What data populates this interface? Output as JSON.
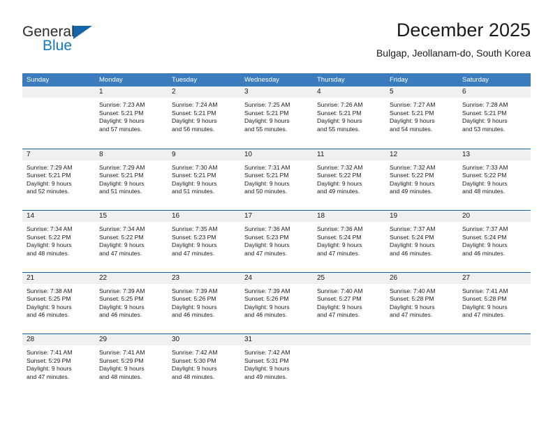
{
  "brand": {
    "name_part1": "General",
    "name_part2": "Blue",
    "accent_color": "#1479bf",
    "triangle_color": "#1565ab"
  },
  "header": {
    "title": "December 2025",
    "subtitle": "Bulgap, Jeollanam-do, South Korea"
  },
  "calendar": {
    "header_bg": "#3a7cbe",
    "rule_color": "#1565ab",
    "daynum_bg": "#f0f0f0",
    "weekday_headers": [
      "Sunday",
      "Monday",
      "Tuesday",
      "Wednesday",
      "Thursday",
      "Friday",
      "Saturday"
    ],
    "weeks": [
      [
        {
          "day": "",
          "sunrise": "",
          "sunset": "",
          "daylight_line1": "",
          "daylight_line2": "",
          "empty": true
        },
        {
          "day": "1",
          "sunrise": "Sunrise: 7:23 AM",
          "sunset": "Sunset: 5:21 PM",
          "daylight_line1": "Daylight: 9 hours",
          "daylight_line2": "and 57 minutes."
        },
        {
          "day": "2",
          "sunrise": "Sunrise: 7:24 AM",
          "sunset": "Sunset: 5:21 PM",
          "daylight_line1": "Daylight: 9 hours",
          "daylight_line2": "and 56 minutes."
        },
        {
          "day": "3",
          "sunrise": "Sunrise: 7:25 AM",
          "sunset": "Sunset: 5:21 PM",
          "daylight_line1": "Daylight: 9 hours",
          "daylight_line2": "and 55 minutes."
        },
        {
          "day": "4",
          "sunrise": "Sunrise: 7:26 AM",
          "sunset": "Sunset: 5:21 PM",
          "daylight_line1": "Daylight: 9 hours",
          "daylight_line2": "and 55 minutes."
        },
        {
          "day": "5",
          "sunrise": "Sunrise: 7:27 AM",
          "sunset": "Sunset: 5:21 PM",
          "daylight_line1": "Daylight: 9 hours",
          "daylight_line2": "and 54 minutes."
        },
        {
          "day": "6",
          "sunrise": "Sunrise: 7:28 AM",
          "sunset": "Sunset: 5:21 PM",
          "daylight_line1": "Daylight: 9 hours",
          "daylight_line2": "and 53 minutes."
        }
      ],
      [
        {
          "day": "7",
          "sunrise": "Sunrise: 7:29 AM",
          "sunset": "Sunset: 5:21 PM",
          "daylight_line1": "Daylight: 9 hours",
          "daylight_line2": "and 52 minutes."
        },
        {
          "day": "8",
          "sunrise": "Sunrise: 7:29 AM",
          "sunset": "Sunset: 5:21 PM",
          "daylight_line1": "Daylight: 9 hours",
          "daylight_line2": "and 51 minutes."
        },
        {
          "day": "9",
          "sunrise": "Sunrise: 7:30 AM",
          "sunset": "Sunset: 5:21 PM",
          "daylight_line1": "Daylight: 9 hours",
          "daylight_line2": "and 51 minutes."
        },
        {
          "day": "10",
          "sunrise": "Sunrise: 7:31 AM",
          "sunset": "Sunset: 5:21 PM",
          "daylight_line1": "Daylight: 9 hours",
          "daylight_line2": "and 50 minutes."
        },
        {
          "day": "11",
          "sunrise": "Sunrise: 7:32 AM",
          "sunset": "Sunset: 5:22 PM",
          "daylight_line1": "Daylight: 9 hours",
          "daylight_line2": "and 49 minutes."
        },
        {
          "day": "12",
          "sunrise": "Sunrise: 7:32 AM",
          "sunset": "Sunset: 5:22 PM",
          "daylight_line1": "Daylight: 9 hours",
          "daylight_line2": "and 49 minutes."
        },
        {
          "day": "13",
          "sunrise": "Sunrise: 7:33 AM",
          "sunset": "Sunset: 5:22 PM",
          "daylight_line1": "Daylight: 9 hours",
          "daylight_line2": "and 48 minutes."
        }
      ],
      [
        {
          "day": "14",
          "sunrise": "Sunrise: 7:34 AM",
          "sunset": "Sunset: 5:22 PM",
          "daylight_line1": "Daylight: 9 hours",
          "daylight_line2": "and 48 minutes."
        },
        {
          "day": "15",
          "sunrise": "Sunrise: 7:34 AM",
          "sunset": "Sunset: 5:22 PM",
          "daylight_line1": "Daylight: 9 hours",
          "daylight_line2": "and 47 minutes."
        },
        {
          "day": "16",
          "sunrise": "Sunrise: 7:35 AM",
          "sunset": "Sunset: 5:23 PM",
          "daylight_line1": "Daylight: 9 hours",
          "daylight_line2": "and 47 minutes."
        },
        {
          "day": "17",
          "sunrise": "Sunrise: 7:36 AM",
          "sunset": "Sunset: 5:23 PM",
          "daylight_line1": "Daylight: 9 hours",
          "daylight_line2": "and 47 minutes."
        },
        {
          "day": "18",
          "sunrise": "Sunrise: 7:36 AM",
          "sunset": "Sunset: 5:24 PM",
          "daylight_line1": "Daylight: 9 hours",
          "daylight_line2": "and 47 minutes."
        },
        {
          "day": "19",
          "sunrise": "Sunrise: 7:37 AM",
          "sunset": "Sunset: 5:24 PM",
          "daylight_line1": "Daylight: 9 hours",
          "daylight_line2": "and 46 minutes."
        },
        {
          "day": "20",
          "sunrise": "Sunrise: 7:37 AM",
          "sunset": "Sunset: 5:24 PM",
          "daylight_line1": "Daylight: 9 hours",
          "daylight_line2": "and 46 minutes."
        }
      ],
      [
        {
          "day": "21",
          "sunrise": "Sunrise: 7:38 AM",
          "sunset": "Sunset: 5:25 PM",
          "daylight_line1": "Daylight: 9 hours",
          "daylight_line2": "and 46 minutes."
        },
        {
          "day": "22",
          "sunrise": "Sunrise: 7:39 AM",
          "sunset": "Sunset: 5:25 PM",
          "daylight_line1": "Daylight: 9 hours",
          "daylight_line2": "and 46 minutes."
        },
        {
          "day": "23",
          "sunrise": "Sunrise: 7:39 AM",
          "sunset": "Sunset: 5:26 PM",
          "daylight_line1": "Daylight: 9 hours",
          "daylight_line2": "and 46 minutes."
        },
        {
          "day": "24",
          "sunrise": "Sunrise: 7:39 AM",
          "sunset": "Sunset: 5:26 PM",
          "daylight_line1": "Daylight: 9 hours",
          "daylight_line2": "and 46 minutes."
        },
        {
          "day": "25",
          "sunrise": "Sunrise: 7:40 AM",
          "sunset": "Sunset: 5:27 PM",
          "daylight_line1": "Daylight: 9 hours",
          "daylight_line2": "and 47 minutes."
        },
        {
          "day": "26",
          "sunrise": "Sunrise: 7:40 AM",
          "sunset": "Sunset: 5:28 PM",
          "daylight_line1": "Daylight: 9 hours",
          "daylight_line2": "and 47 minutes."
        },
        {
          "day": "27",
          "sunrise": "Sunrise: 7:41 AM",
          "sunset": "Sunset: 5:28 PM",
          "daylight_line1": "Daylight: 9 hours",
          "daylight_line2": "and 47 minutes."
        }
      ],
      [
        {
          "day": "28",
          "sunrise": "Sunrise: 7:41 AM",
          "sunset": "Sunset: 5:29 PM",
          "daylight_line1": "Daylight: 9 hours",
          "daylight_line2": "and 47 minutes."
        },
        {
          "day": "29",
          "sunrise": "Sunrise: 7:41 AM",
          "sunset": "Sunset: 5:29 PM",
          "daylight_line1": "Daylight: 9 hours",
          "daylight_line2": "and 48 minutes."
        },
        {
          "day": "30",
          "sunrise": "Sunrise: 7:42 AM",
          "sunset": "Sunset: 5:30 PM",
          "daylight_line1": "Daylight: 9 hours",
          "daylight_line2": "and 48 minutes."
        },
        {
          "day": "31",
          "sunrise": "Sunrise: 7:42 AM",
          "sunset": "Sunset: 5:31 PM",
          "daylight_line1": "Daylight: 9 hours",
          "daylight_line2": "and 49 minutes."
        },
        {
          "day": "",
          "sunrise": "",
          "sunset": "",
          "daylight_line1": "",
          "daylight_line2": "",
          "empty": true
        },
        {
          "day": "",
          "sunrise": "",
          "sunset": "",
          "daylight_line1": "",
          "daylight_line2": "",
          "empty": true
        },
        {
          "day": "",
          "sunrise": "",
          "sunset": "",
          "daylight_line1": "",
          "daylight_line2": "",
          "empty": true
        }
      ]
    ]
  }
}
